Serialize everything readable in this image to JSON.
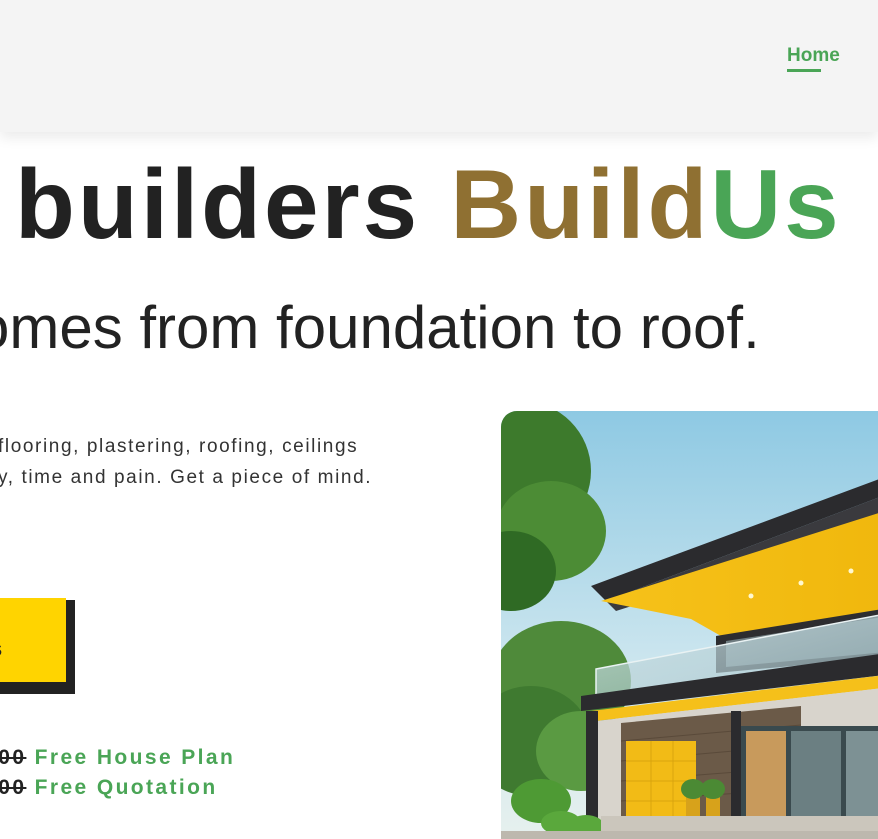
{
  "header": {
    "nav": {
      "home_label": "Home"
    }
  },
  "hero": {
    "title_part1": "builders ",
    "title_build": "Build",
    "title_us": "Us",
    "subtitle": "omes from foundation to roof.",
    "description_line1": "flooring, plastering, roofing, ceilings",
    "description_line2": "y, time and pain. Get a piece of mind.",
    "cta_label": "s",
    "offers": [
      {
        "old_price": ".00",
        "label": "Free House Plan"
      },
      {
        "old_price": ".00",
        "label": "Free Quotation"
      }
    ],
    "image_icon": "modern-house-photo"
  },
  "colors": {
    "accent_green": "#4aa556",
    "accent_gold": "#8f7032",
    "cta_yellow": "#ffd400",
    "header_bg": "#f4f4f4"
  }
}
